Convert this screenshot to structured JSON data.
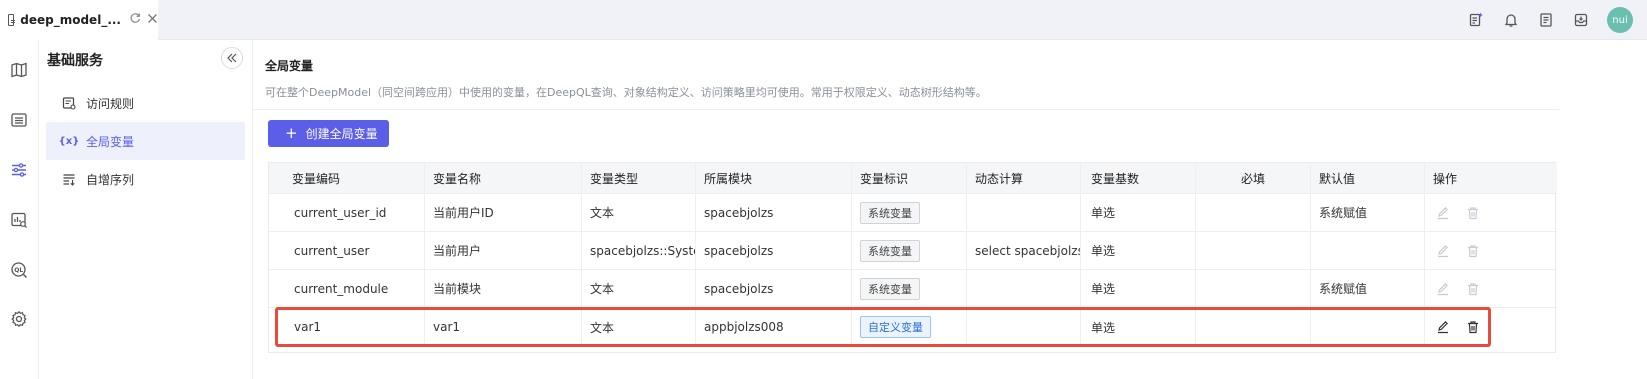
{
  "tab": {
    "title": "deep_model_..."
  },
  "avatar": {
    "text": "nui"
  },
  "sidebar": {
    "title": "基础服务",
    "items": [
      {
        "label": "访问规则"
      },
      {
        "label": "全局变量"
      },
      {
        "label": "自增序列"
      }
    ]
  },
  "main": {
    "title": "全局变量",
    "description": "可在整个DeepModel（同空间跨应用）中使用的变量，在DeepQL查询、对象结构定义、访问策略里均可使用。常用于权限定义、动态树形结构等。",
    "create_label": "创建全局变量"
  },
  "table": {
    "headers": [
      "变量编码",
      "变量名称",
      "变量类型",
      "所属模块",
      "变量标识",
      "动态计算",
      "变量基数",
      "必填",
      "默认值",
      "操作"
    ],
    "rows": [
      {
        "code": "current_user_id",
        "name": "当前用户ID",
        "type": "文本",
        "module": "spacebjolzs",
        "tag": "系统变量",
        "dynamic": "",
        "cardinality": "单选",
        "required": "",
        "default": "系统赋值"
      },
      {
        "code": "current_user",
        "name": "当前用户",
        "type": "spacebjolzs::Syste...",
        "module": "spacebjolzs",
        "tag": "系统变量",
        "dynamic": "select spacebjolzs...",
        "cardinality": "单选",
        "required": "",
        "default": ""
      },
      {
        "code": "current_module",
        "name": "当前模块",
        "type": "文本",
        "module": "spacebjolzs",
        "tag": "系统变量",
        "dynamic": "",
        "cardinality": "单选",
        "required": "",
        "default": "系统赋值"
      },
      {
        "code": "var1",
        "name": "var1",
        "type": "文本",
        "module": "appbjolzs008",
        "tag": "自定义变量",
        "dynamic": "",
        "cardinality": "单选",
        "required": "",
        "default": ""
      }
    ]
  },
  "colors": {
    "accent": "#5b5ee6",
    "highlight": "#e84a3c",
    "avatar": "#6bbfb0"
  }
}
